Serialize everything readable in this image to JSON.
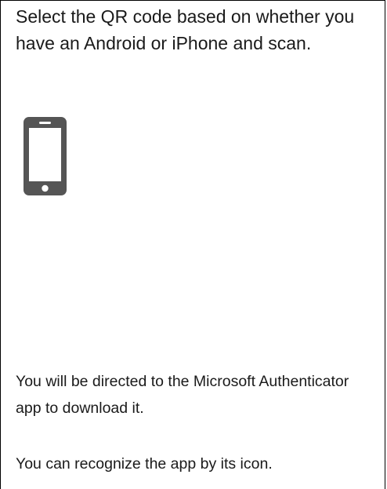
{
  "instruction": {
    "heading": "Select the QR code based on whether you have an Android or iPhone and scan."
  },
  "device": {
    "icon": "smartphone-icon",
    "color": "#555555"
  },
  "notes": {
    "directed": "You will be directed to the Microsoft Authenticator app to download it.",
    "recognize": "You can recognize the app by its icon."
  }
}
